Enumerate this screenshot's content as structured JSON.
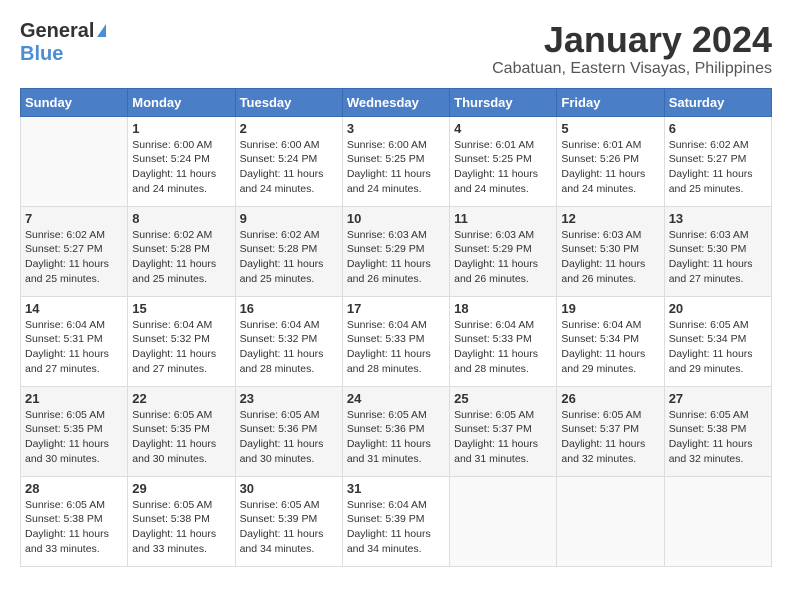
{
  "logo": {
    "general": "General",
    "blue": "Blue"
  },
  "title": "January 2024",
  "location": "Cabatuan, Eastern Visayas, Philippines",
  "weekdays": [
    "Sunday",
    "Monday",
    "Tuesday",
    "Wednesday",
    "Thursday",
    "Friday",
    "Saturday"
  ],
  "weeks": [
    [
      {
        "day": "",
        "sunrise": "",
        "sunset": "",
        "daylight": ""
      },
      {
        "day": "1",
        "sunrise": "Sunrise: 6:00 AM",
        "sunset": "Sunset: 5:24 PM",
        "daylight": "Daylight: 11 hours and 24 minutes."
      },
      {
        "day": "2",
        "sunrise": "Sunrise: 6:00 AM",
        "sunset": "Sunset: 5:24 PM",
        "daylight": "Daylight: 11 hours and 24 minutes."
      },
      {
        "day": "3",
        "sunrise": "Sunrise: 6:00 AM",
        "sunset": "Sunset: 5:25 PM",
        "daylight": "Daylight: 11 hours and 24 minutes."
      },
      {
        "day": "4",
        "sunrise": "Sunrise: 6:01 AM",
        "sunset": "Sunset: 5:25 PM",
        "daylight": "Daylight: 11 hours and 24 minutes."
      },
      {
        "day": "5",
        "sunrise": "Sunrise: 6:01 AM",
        "sunset": "Sunset: 5:26 PM",
        "daylight": "Daylight: 11 hours and 24 minutes."
      },
      {
        "day": "6",
        "sunrise": "Sunrise: 6:02 AM",
        "sunset": "Sunset: 5:27 PM",
        "daylight": "Daylight: 11 hours and 25 minutes."
      }
    ],
    [
      {
        "day": "7",
        "sunrise": "Sunrise: 6:02 AM",
        "sunset": "Sunset: 5:27 PM",
        "daylight": "Daylight: 11 hours and 25 minutes."
      },
      {
        "day": "8",
        "sunrise": "Sunrise: 6:02 AM",
        "sunset": "Sunset: 5:28 PM",
        "daylight": "Daylight: 11 hours and 25 minutes."
      },
      {
        "day": "9",
        "sunrise": "Sunrise: 6:02 AM",
        "sunset": "Sunset: 5:28 PM",
        "daylight": "Daylight: 11 hours and 25 minutes."
      },
      {
        "day": "10",
        "sunrise": "Sunrise: 6:03 AM",
        "sunset": "Sunset: 5:29 PM",
        "daylight": "Daylight: 11 hours and 26 minutes."
      },
      {
        "day": "11",
        "sunrise": "Sunrise: 6:03 AM",
        "sunset": "Sunset: 5:29 PM",
        "daylight": "Daylight: 11 hours and 26 minutes."
      },
      {
        "day": "12",
        "sunrise": "Sunrise: 6:03 AM",
        "sunset": "Sunset: 5:30 PM",
        "daylight": "Daylight: 11 hours and 26 minutes."
      },
      {
        "day": "13",
        "sunrise": "Sunrise: 6:03 AM",
        "sunset": "Sunset: 5:30 PM",
        "daylight": "Daylight: 11 hours and 27 minutes."
      }
    ],
    [
      {
        "day": "14",
        "sunrise": "Sunrise: 6:04 AM",
        "sunset": "Sunset: 5:31 PM",
        "daylight": "Daylight: 11 hours and 27 minutes."
      },
      {
        "day": "15",
        "sunrise": "Sunrise: 6:04 AM",
        "sunset": "Sunset: 5:32 PM",
        "daylight": "Daylight: 11 hours and 27 minutes."
      },
      {
        "day": "16",
        "sunrise": "Sunrise: 6:04 AM",
        "sunset": "Sunset: 5:32 PM",
        "daylight": "Daylight: 11 hours and 28 minutes."
      },
      {
        "day": "17",
        "sunrise": "Sunrise: 6:04 AM",
        "sunset": "Sunset: 5:33 PM",
        "daylight": "Daylight: 11 hours and 28 minutes."
      },
      {
        "day": "18",
        "sunrise": "Sunrise: 6:04 AM",
        "sunset": "Sunset: 5:33 PM",
        "daylight": "Daylight: 11 hours and 28 minutes."
      },
      {
        "day": "19",
        "sunrise": "Sunrise: 6:04 AM",
        "sunset": "Sunset: 5:34 PM",
        "daylight": "Daylight: 11 hours and 29 minutes."
      },
      {
        "day": "20",
        "sunrise": "Sunrise: 6:05 AM",
        "sunset": "Sunset: 5:34 PM",
        "daylight": "Daylight: 11 hours and 29 minutes."
      }
    ],
    [
      {
        "day": "21",
        "sunrise": "Sunrise: 6:05 AM",
        "sunset": "Sunset: 5:35 PM",
        "daylight": "Daylight: 11 hours and 30 minutes."
      },
      {
        "day": "22",
        "sunrise": "Sunrise: 6:05 AM",
        "sunset": "Sunset: 5:35 PM",
        "daylight": "Daylight: 11 hours and 30 minutes."
      },
      {
        "day": "23",
        "sunrise": "Sunrise: 6:05 AM",
        "sunset": "Sunset: 5:36 PM",
        "daylight": "Daylight: 11 hours and 30 minutes."
      },
      {
        "day": "24",
        "sunrise": "Sunrise: 6:05 AM",
        "sunset": "Sunset: 5:36 PM",
        "daylight": "Daylight: 11 hours and 31 minutes."
      },
      {
        "day": "25",
        "sunrise": "Sunrise: 6:05 AM",
        "sunset": "Sunset: 5:37 PM",
        "daylight": "Daylight: 11 hours and 31 minutes."
      },
      {
        "day": "26",
        "sunrise": "Sunrise: 6:05 AM",
        "sunset": "Sunset: 5:37 PM",
        "daylight": "Daylight: 11 hours and 32 minutes."
      },
      {
        "day": "27",
        "sunrise": "Sunrise: 6:05 AM",
        "sunset": "Sunset: 5:38 PM",
        "daylight": "Daylight: 11 hours and 32 minutes."
      }
    ],
    [
      {
        "day": "28",
        "sunrise": "Sunrise: 6:05 AM",
        "sunset": "Sunset: 5:38 PM",
        "daylight": "Daylight: 11 hours and 33 minutes."
      },
      {
        "day": "29",
        "sunrise": "Sunrise: 6:05 AM",
        "sunset": "Sunset: 5:38 PM",
        "daylight": "Daylight: 11 hours and 33 minutes."
      },
      {
        "day": "30",
        "sunrise": "Sunrise: 6:05 AM",
        "sunset": "Sunset: 5:39 PM",
        "daylight": "Daylight: 11 hours and 34 minutes."
      },
      {
        "day": "31",
        "sunrise": "Sunrise: 6:04 AM",
        "sunset": "Sunset: 5:39 PM",
        "daylight": "Daylight: 11 hours and 34 minutes."
      },
      {
        "day": "",
        "sunrise": "",
        "sunset": "",
        "daylight": ""
      },
      {
        "day": "",
        "sunrise": "",
        "sunset": "",
        "daylight": ""
      },
      {
        "day": "",
        "sunrise": "",
        "sunset": "",
        "daylight": ""
      }
    ]
  ]
}
